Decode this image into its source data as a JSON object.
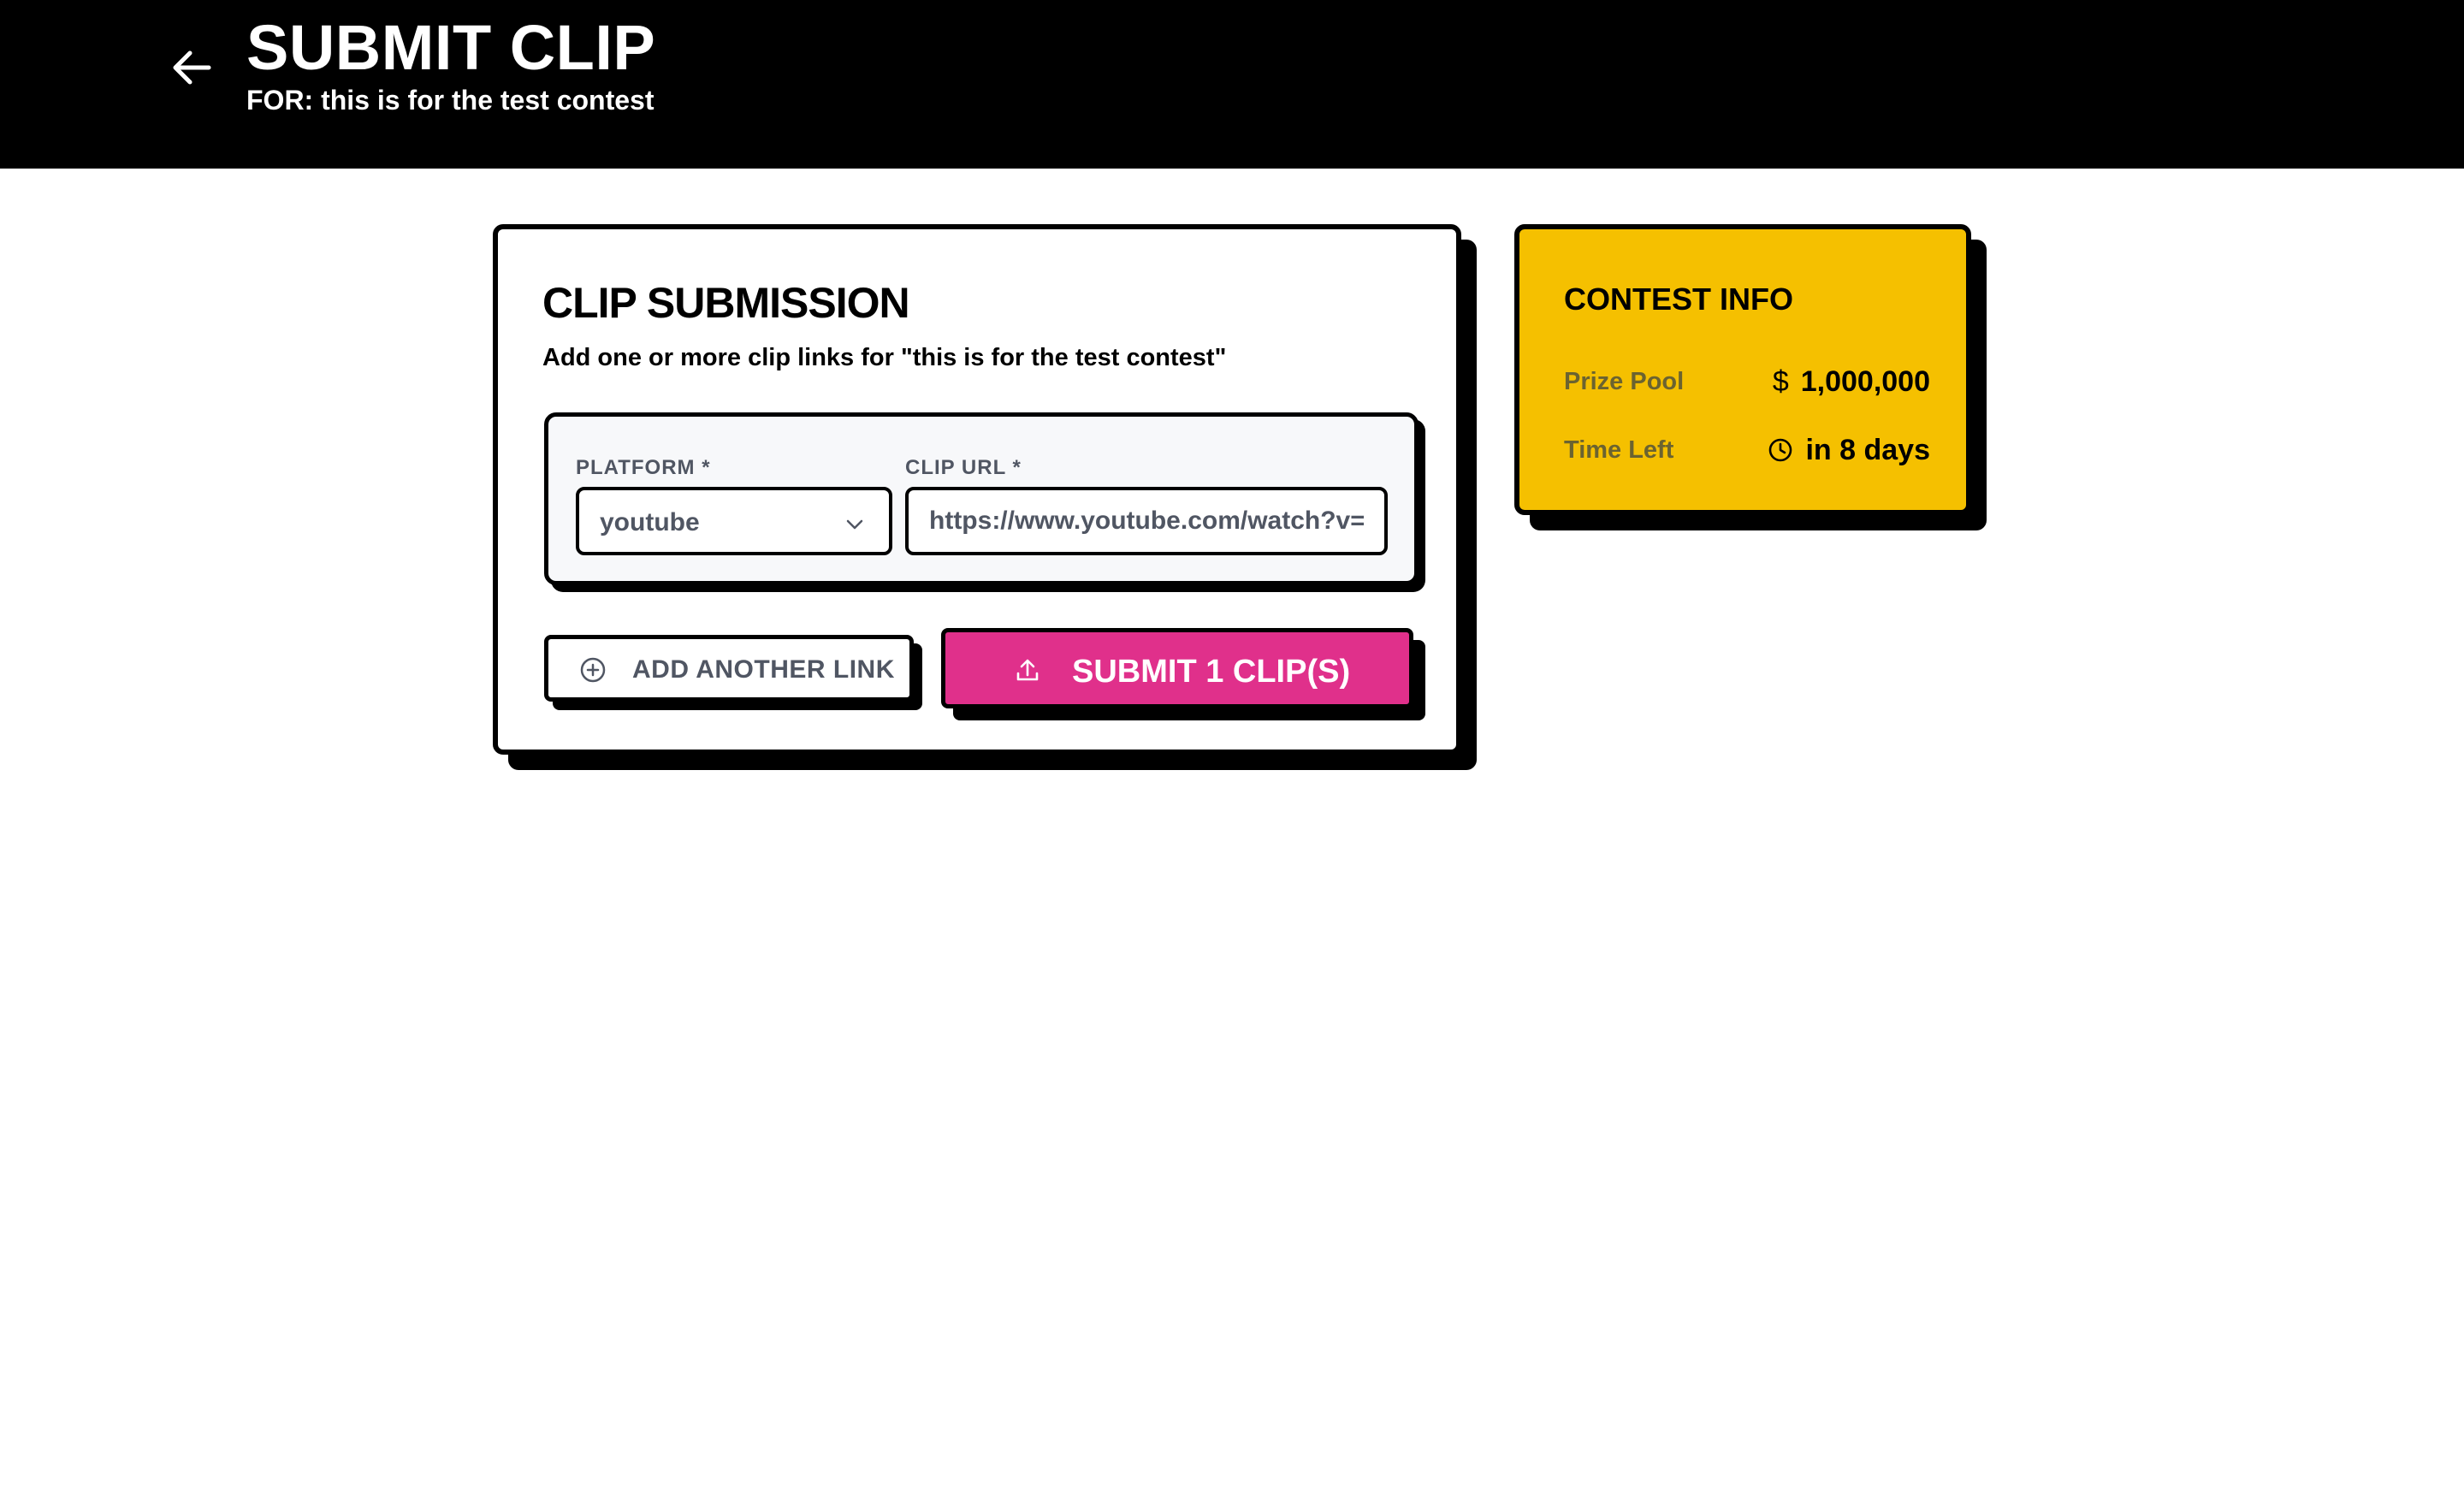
{
  "header": {
    "title": "SUBMIT CLIP",
    "subtitle": "FOR: this is for the test contest",
    "back_icon": "arrow-left-icon"
  },
  "submission": {
    "title": "CLIP SUBMISSION",
    "description": "Add one or more clip links for \"this is for the test contest\"",
    "platform_label": "PLATFORM *",
    "platform_value": "youtube",
    "url_label": "CLIP URL *",
    "url_value": "https://www.youtube.com/watch?v=lOhTAj",
    "add_link_label": "ADD ANOTHER LINK",
    "submit_label": "SUBMIT 1 CLIP(S)",
    "submit_color": "#e0308b"
  },
  "contest_info": {
    "title": "CONTEST INFO",
    "prize_label": "Prize Pool",
    "prize_currency": "$",
    "prize_value": "1,000,000",
    "time_label": "Time Left",
    "time_value": "in 8 days",
    "card_color": "#f5c000"
  }
}
